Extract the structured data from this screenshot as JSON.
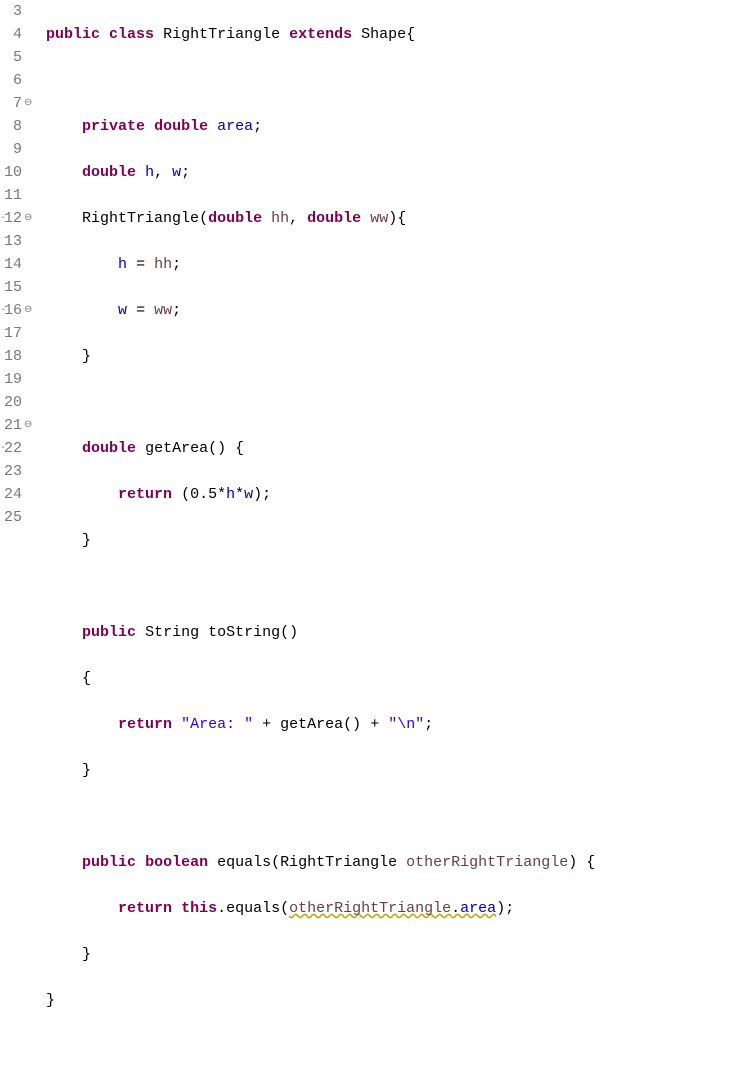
{
  "lines": [
    {
      "n": "3",
      "marker": "",
      "dash": ""
    },
    {
      "n": "4",
      "marker": "",
      "dash": ""
    },
    {
      "n": "5",
      "marker": "",
      "dash": ""
    },
    {
      "n": "6",
      "marker": "",
      "dash": ""
    },
    {
      "n": "7",
      "marker": "⊖",
      "dash": ""
    },
    {
      "n": "8",
      "marker": "",
      "dash": ""
    },
    {
      "n": "9",
      "marker": "",
      "dash": ""
    },
    {
      "n": "10",
      "marker": "",
      "dash": ""
    },
    {
      "n": "11",
      "marker": "",
      "dash": ""
    },
    {
      "n": "12",
      "marker": "⊖",
      "dash": "-"
    },
    {
      "n": "13",
      "marker": "",
      "dash": ""
    },
    {
      "n": "14",
      "marker": "",
      "dash": ""
    },
    {
      "n": "15",
      "marker": "",
      "dash": ""
    },
    {
      "n": "16",
      "marker": "⊖",
      "dash": "-"
    },
    {
      "n": "17",
      "marker": "",
      "dash": ""
    },
    {
      "n": "18",
      "marker": "",
      "dash": ""
    },
    {
      "n": "19",
      "marker": "",
      "dash": ""
    },
    {
      "n": "20",
      "marker": "",
      "dash": ""
    },
    {
      "n": "21",
      "marker": "⊖",
      "dash": ""
    },
    {
      "n": "22",
      "marker": "",
      "dash": "-"
    },
    {
      "n": "23",
      "marker": "",
      "dash": ""
    },
    {
      "n": "24",
      "marker": "",
      "dash": ""
    },
    {
      "n": "25",
      "marker": "",
      "dash": ""
    }
  ],
  "t": {
    "public": "public",
    "class": "class",
    "RightTriangle": "RightTriangle",
    "extends": "extends",
    "Shape": "Shape",
    "private": "private",
    "double": "double",
    "area": "area",
    "h": "h",
    "w": "w",
    "hh": "hh",
    "ww": "ww",
    "return": "return",
    "getArea": "getArea",
    "String": "String",
    "toString": "toString",
    "strArea": "\"Area: \"",
    "strNl": "\"\\n\"",
    "boolean": "boolean",
    "equals": "equals",
    "otherRightTriangle": "otherRightTriangle",
    "this": "this",
    "half": "0.5",
    "lbrace": "{",
    "rbrace": "}",
    "lparen": "(",
    "rparen": ")",
    "semi": ";",
    "comma": ",",
    "eq": "=",
    "star": "*",
    "plus": "+",
    "dot": "."
  }
}
